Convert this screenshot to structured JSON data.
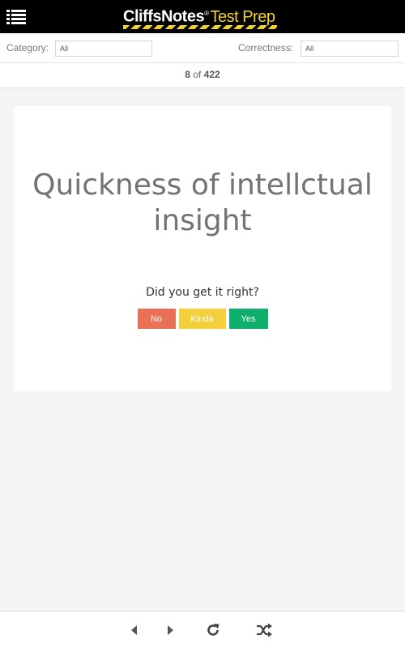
{
  "header": {
    "logo_brand": "CliffsNotes",
    "logo_reg": "®",
    "logo_suffix": "Test Prep",
    "menu_icon": "hamburger-list-icon"
  },
  "filters": {
    "category_label": "Category:",
    "category_value": "All",
    "correctness_label": "Correctness:",
    "correctness_value": "All"
  },
  "counter": {
    "current": "8",
    "separator": "of",
    "total": "422"
  },
  "card": {
    "term": "Quickness of intellctual insight",
    "question": "Did you get it right?",
    "buttons": {
      "no": "No",
      "kinda": "Kinda",
      "yes": "Yes"
    }
  },
  "colors": {
    "no": "#ea7153",
    "kinda": "#f3cf3c",
    "yes": "#0eae6c",
    "brand_yellow": "#f2d230"
  },
  "footer": {
    "icons": [
      "triangle-left-icon",
      "triangle-right-icon",
      "refresh-icon",
      "shuffle-icon"
    ]
  }
}
